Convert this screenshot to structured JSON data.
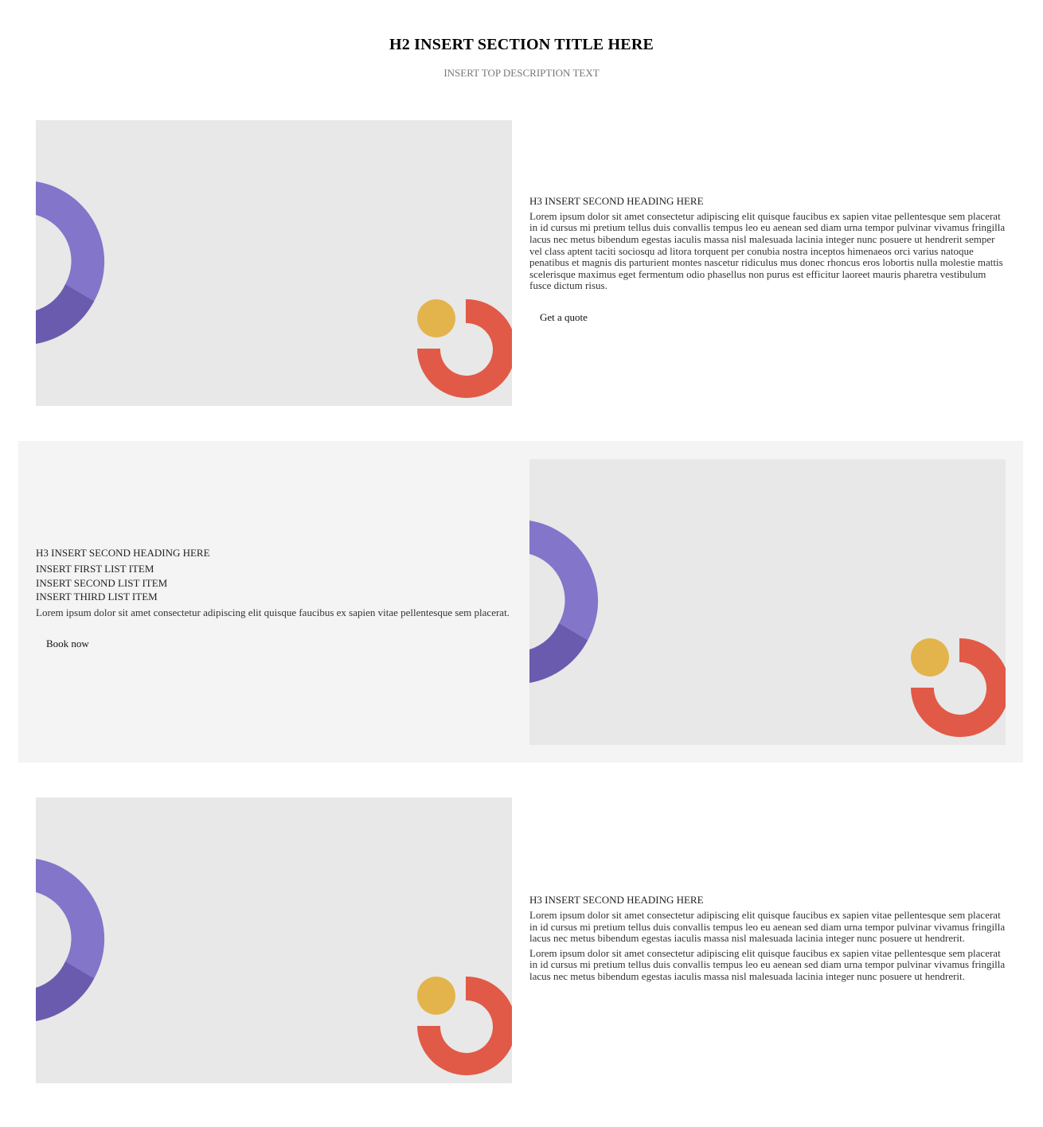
{
  "section": {
    "title": "H2 INSERT SECTION TITLE HERE",
    "description": "INSERT TOP DESCRIPTION TEXT"
  },
  "colors": {
    "placeholder_bg": "#e8e8e8",
    "band_bg": "#f4f4f4",
    "purple_light": "#8375c9",
    "purple_dark": "#6b5baf",
    "coral": "#e15a47",
    "yellow": "#e3b44c"
  },
  "rows": [
    {
      "heading": "H3 INSERT SECOND HEADING HERE",
      "paragraph": "Lorem ipsum dolor sit amet consectetur adipiscing elit quisque faucibus ex sapien vitae pellentesque sem placerat in id cursus mi pretium tellus duis convallis tempus leo eu aenean sed diam urna tempor pulvinar vivamus fringilla lacus nec metus bibendum egestas iaculis massa nisl malesuada lacinia integer nunc posuere ut hendrerit semper vel class aptent taciti sociosqu ad litora torquent per conubia nostra inceptos himenaeos orci varius natoque penatibus et magnis dis parturient montes nascetur ridiculus mus donec rhoncus eros lobortis nulla molestie mattis scelerisque maximus eget fermentum odio phasellus non purus est efficitur laoreet mauris pharetra vestibulum fusce dictum risus.",
      "button": "Get a quote"
    },
    {
      "heading": "H3 INSERT SECOND HEADING HERE",
      "list": [
        "INSERT FIRST LIST ITEM",
        "INSERT SECOND LIST ITEM",
        "INSERT THIRD LIST ITEM"
      ],
      "paragraph": "Lorem ipsum dolor sit amet consectetur adipiscing elit quisque faucibus ex sapien vitae pellentesque sem placerat.",
      "button": "Book now"
    },
    {
      "heading": "H3 INSERT SECOND HEADING HERE",
      "paragraph1": "Lorem ipsum dolor sit amet consectetur adipiscing elit quisque faucibus ex sapien vitae pellentesque sem placerat in id cursus mi pretium tellus duis convallis tempus leo eu aenean sed diam urna tempor pulvinar vivamus fringilla lacus nec metus bibendum egestas iaculis massa nisl malesuada lacinia integer nunc posuere ut hendrerit.",
      "paragraph2": "Lorem ipsum dolor sit amet consectetur adipiscing elit quisque faucibus ex sapien vitae pellentesque sem placerat in id cursus mi pretium tellus duis convallis tempus leo eu aenean sed diam urna tempor pulvinar vivamus fringilla lacus nec metus bibendum egestas iaculis massa nisl malesuada lacinia integer nunc posuere ut hendrerit."
    }
  ]
}
